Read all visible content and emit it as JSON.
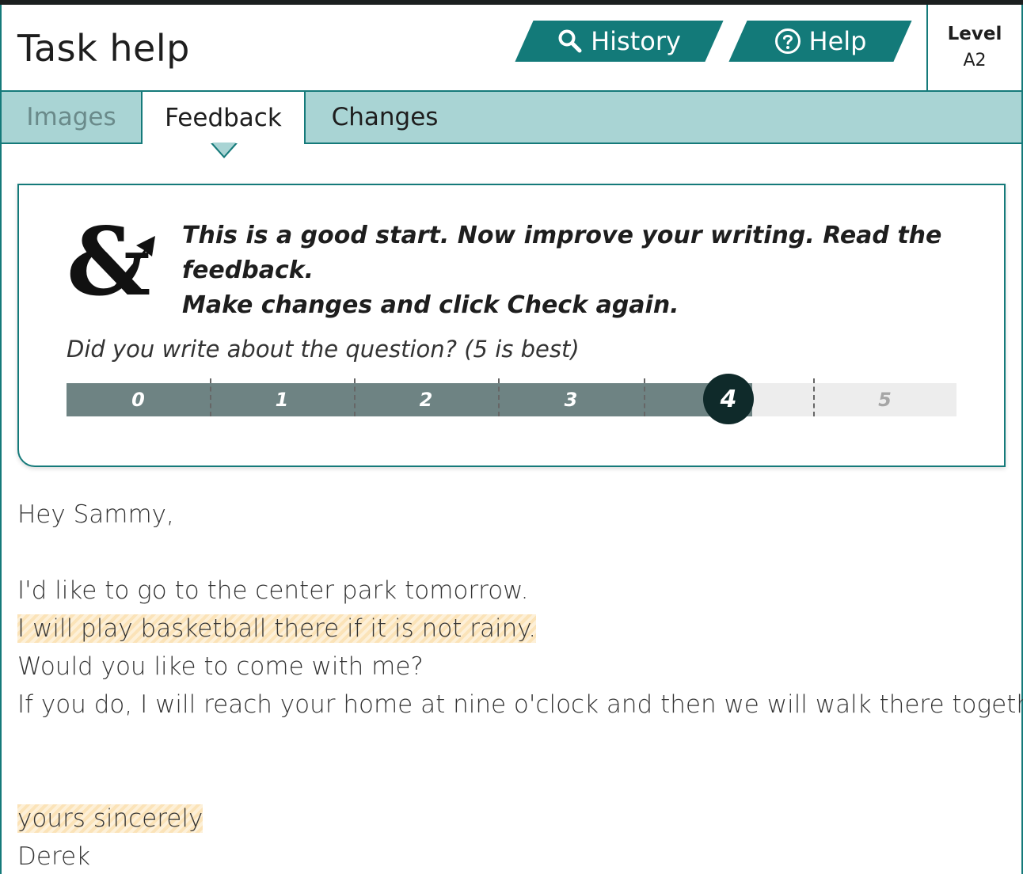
{
  "header": {
    "title": "Task help",
    "history_label": "History",
    "help_label": "Help",
    "level_label": "Level",
    "level_value": "A2"
  },
  "tabs": [
    {
      "label": "Images",
      "state": "inactive"
    },
    {
      "label": "Feedback",
      "state": "active"
    },
    {
      "label": "Changes",
      "state": "inactive"
    }
  ],
  "feedback": {
    "message_line1": "This is a good start. Now improve your writing. Read the feedback.",
    "message_line2": "Make changes and click Check again.",
    "question": "Did you write about the question? (5 is best)",
    "scale_labels": [
      "0",
      "1",
      "2",
      "3",
      "4",
      "5"
    ],
    "score": 4
  },
  "letter": {
    "lines": [
      {
        "text": "Hey Sammy,",
        "highlight": false
      },
      {
        "text": "",
        "highlight": false
      },
      {
        "text": "I'd like to go to the center park tomorrow.",
        "highlight": false
      },
      {
        "text": "I will play basketball there if it is not rainy.",
        "highlight": true
      },
      {
        "text": "Would you like to come with me?",
        "highlight": false
      },
      {
        "text": "If you do, I will reach your home at nine o'clock and then we will walk there together.",
        "highlight": false
      },
      {
        "text": "",
        "highlight": false
      },
      {
        "text": "",
        "highlight": false
      },
      {
        "text": "yours sincerely",
        "highlight": true
      },
      {
        "text": "Derek",
        "highlight": false
      }
    ]
  },
  "colors": {
    "accent": "#137a79",
    "tab_bar": "#a9d4d4",
    "scale_fill": "#6e8383",
    "marker": "#0f2a2a",
    "highlight": "#fbe3b8"
  },
  "icons": {
    "history": "search-icon",
    "help": "question-circle-icon",
    "logo": "ampersand-arrow-logo"
  }
}
